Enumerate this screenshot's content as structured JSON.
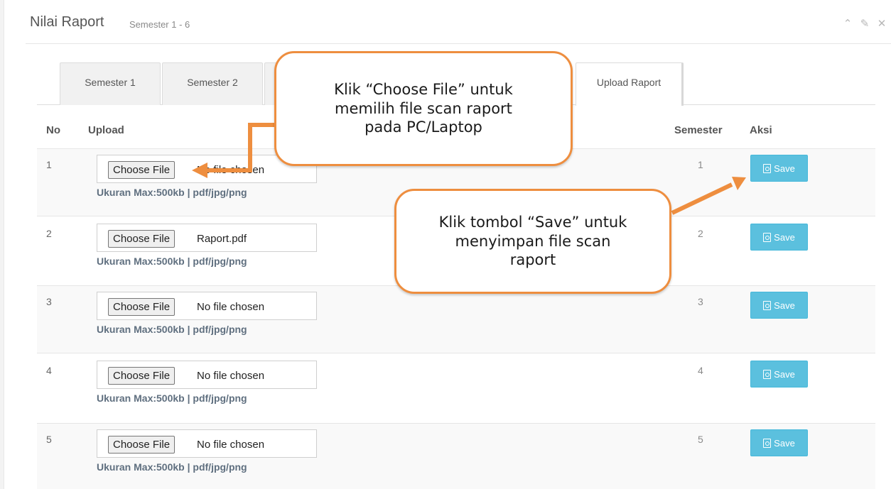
{
  "header": {
    "title": "Nilai Raport",
    "subtitle": "Semester 1 - 6",
    "tools": {
      "collapse_icon": "chevron-up-icon",
      "settings_icon": "wrench-icon",
      "close_icon": "close-icon"
    }
  },
  "tabs": [
    {
      "label": "Semester 1"
    },
    {
      "label": "Semester 2"
    },
    {
      "label": "Upload Raport"
    }
  ],
  "table": {
    "headers": {
      "no": "No",
      "upload": "Upload",
      "semester": "Semester",
      "aksi": "Aksi"
    },
    "rows": [
      {
        "no": "1",
        "choose_label": "Choose File",
        "file_name": "No file chosen",
        "hint": "Ukuran Max:500kb | pdf/jpg/png",
        "semester": "1",
        "save_label": "Save"
      },
      {
        "no": "2",
        "choose_label": "Choose File",
        "file_name": "Raport.pdf",
        "hint": "Ukuran Max:500kb | pdf/jpg/png",
        "semester": "2",
        "save_label": "Save"
      },
      {
        "no": "3",
        "choose_label": "Choose File",
        "file_name": "No file chosen",
        "hint": "Ukuran Max:500kb | pdf/jpg/png",
        "semester": "3",
        "save_label": "Save"
      },
      {
        "no": "4",
        "choose_label": "Choose File",
        "file_name": "No file chosen",
        "hint": "Ukuran Max:500kb | pdf/jpg/png",
        "semester": "4",
        "save_label": "Save"
      },
      {
        "no": "5",
        "choose_label": "Choose File",
        "file_name": "No file chosen",
        "hint": "Ukuran Max:500kb | pdf/jpg/png",
        "semester": "5",
        "save_label": "Save"
      }
    ]
  },
  "callouts": {
    "choose_file": {
      "line1": "Klik “Choose File” untuk",
      "line2": "memilih file scan raport",
      "line3": "pada PC/Laptop"
    },
    "save": {
      "line1": "Klik tombol “Save” untuk",
      "line2": "menyimpan file scan",
      "line3": "raport"
    }
  },
  "colors": {
    "callout_border": "#ee8e3f",
    "save_button": "#5bc0de",
    "hint_text": "#5f6f7f"
  }
}
